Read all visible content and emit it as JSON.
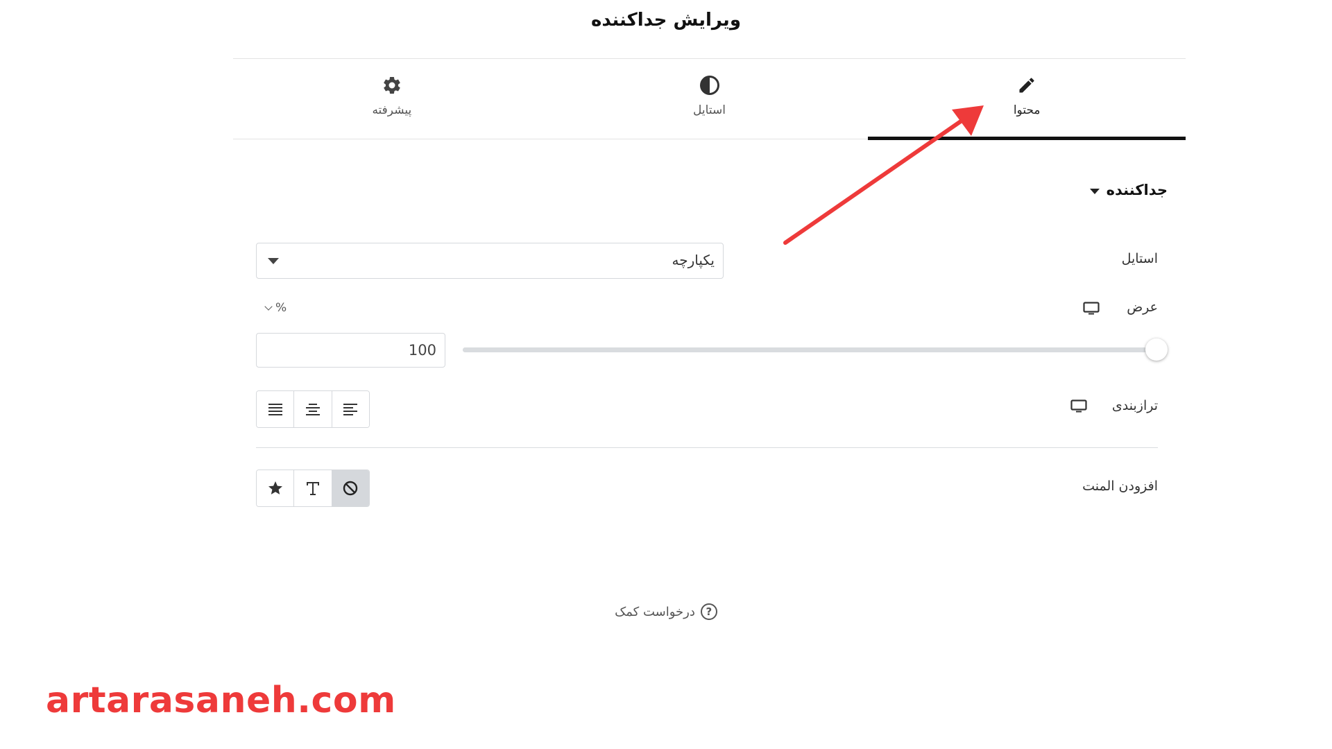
{
  "header": {
    "title": "ویرایش جداکننده"
  },
  "tabs": [
    {
      "label": "محتوا",
      "icon": "pencil-icon",
      "active": true
    },
    {
      "label": "استایل",
      "icon": "contrast-icon",
      "active": false
    },
    {
      "label": "پیشرفته",
      "icon": "gear-icon",
      "active": false
    }
  ],
  "section": {
    "title": "جداکننده"
  },
  "controls": {
    "style": {
      "label": "استایل",
      "value": "یکپارچه"
    },
    "width": {
      "label": "عرض",
      "unit": "%",
      "value": "100",
      "fraction": 1.0
    },
    "alignment": {
      "label": "ترازبندی",
      "options": [
        "align-justify-icon",
        "align-center-icon",
        "align-left-icon"
      ]
    },
    "element": {
      "label": "افزودن المنت",
      "options": [
        "star-icon",
        "text-icon",
        "none-icon"
      ],
      "selected_index": 2
    }
  },
  "help": {
    "label": "درخواست کمک"
  },
  "watermark": {
    "text": "artarasaneh.com"
  },
  "colors": {
    "accent": "#111111",
    "annotation": "#ee3a3a",
    "border": "#d5d8dc"
  }
}
